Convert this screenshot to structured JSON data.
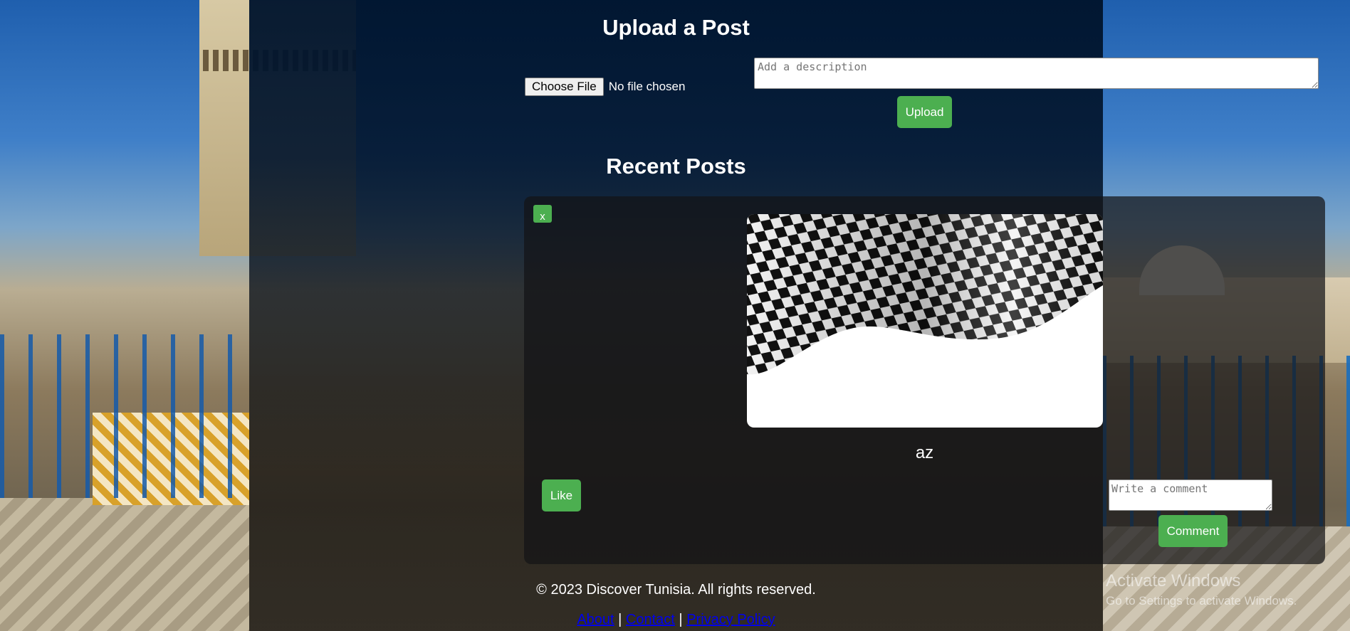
{
  "upload": {
    "title": "Upload a Post",
    "file_button_label": "Choose File",
    "file_status": "No file chosen",
    "description_placeholder": "Add a description",
    "upload_button_label": "Upload"
  },
  "recent": {
    "title": "Recent Posts",
    "posts": [
      {
        "delete_label": "x",
        "image_icon": "checkered-flag",
        "description": "az",
        "like_label": "Like",
        "comment_placeholder": "Write a comment",
        "comment_button_label": "Comment"
      }
    ]
  },
  "footer": {
    "copyright": "© 2023 Discover Tunisia. All rights reserved.",
    "links": [
      "About",
      "Contact",
      "Privacy Policy"
    ],
    "separator": "|"
  },
  "watermark": {
    "title": "Activate Windows",
    "subtitle": "Go to Settings to activate Windows."
  },
  "colors": {
    "accent_green": "#4caf50",
    "link_blue": "#0000ee",
    "panel_dark": "#03162e"
  }
}
